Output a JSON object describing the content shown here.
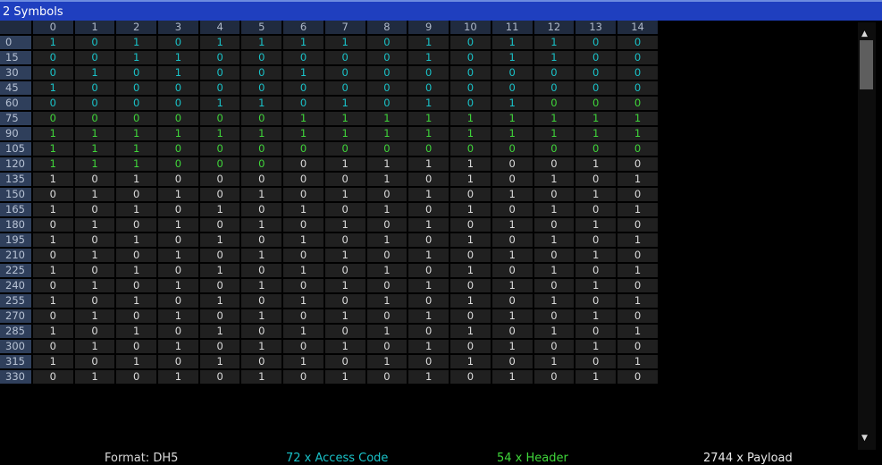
{
  "window": {
    "title": "2 Symbols"
  },
  "colors": {
    "access_code": "#19c2c8",
    "header": "#3fd63a",
    "payload": "#dcdcdc",
    "title_bar": "#1f3fbf",
    "row_header_bg": "#2f3f5b",
    "cell_bg": "#202020"
  },
  "table": {
    "column_headers": [
      "0",
      "1",
      "2",
      "3",
      "4",
      "5",
      "6",
      "7",
      "8",
      "9",
      "10",
      "11",
      "12",
      "13",
      "14"
    ],
    "rows": [
      {
        "label": "0",
        "bits": "101011110101100",
        "types": "AAAAAAAAAAAAAAA"
      },
      {
        "label": "15",
        "bits": "001100000101100",
        "types": "AAAAAAAAAAAAAAA"
      },
      {
        "label": "30",
        "bits": "010100100000000",
        "types": "AAAAAAAAAAAAAAA"
      },
      {
        "label": "45",
        "bits": "100000000000000",
        "types": "AAAAAAAAAAAAAAA"
      },
      {
        "label": "60",
        "bits": "000011010101000",
        "types": "AAAAAAAAAAAAHHH"
      },
      {
        "label": "75",
        "bits": "000000111111111",
        "types": "HHHHHHHHHHHHHHH"
      },
      {
        "label": "90",
        "bits": "111111111111111",
        "types": "HHHHHHHHHHHHHHH"
      },
      {
        "label": "105",
        "bits": "111000000000000",
        "types": "HHHHHHHHHHHHHHH"
      },
      {
        "label": "120",
        "bits": "111000011110010",
        "types": "HHHHHHPPPPPPPPP"
      },
      {
        "label": "135",
        "bits": "101000001010101",
        "types": "PPPPPPPPPPPPPPP"
      },
      {
        "label": "150",
        "bits": "010101010101010",
        "types": "PPPPPPPPPPPPPPP"
      },
      {
        "label": "165",
        "bits": "101010101010101",
        "types": "PPPPPPPPPPPPPPP"
      },
      {
        "label": "180",
        "bits": "010101010101010",
        "types": "PPPPPPPPPPPPPPP"
      },
      {
        "label": "195",
        "bits": "101010101010101",
        "types": "PPPPPPPPPPPPPPP"
      },
      {
        "label": "210",
        "bits": "010101010101010",
        "types": "PPPPPPPPPPPPPPP"
      },
      {
        "label": "225",
        "bits": "101010101010101",
        "types": "PPPPPPPPPPPPPPP"
      },
      {
        "label": "240",
        "bits": "010101010101010",
        "types": "PPPPPPPPPPPPPPP"
      },
      {
        "label": "255",
        "bits": "101010101010101",
        "types": "PPPPPPPPPPPPPPP"
      },
      {
        "label": "270",
        "bits": "010101010101010",
        "types": "PPPPPPPPPPPPPPP"
      },
      {
        "label": "285",
        "bits": "101010101010101",
        "types": "PPPPPPPPPPPPPPP"
      },
      {
        "label": "300",
        "bits": "010101010101010",
        "types": "PPPPPPPPPPPPPPP"
      },
      {
        "label": "315",
        "bits": "101010101010101",
        "types": "PPPPPPPPPPPPPPP"
      },
      {
        "label": "330",
        "bits": "010101010101010",
        "types": "PPPPPPPPPPPPPPP"
      }
    ]
  },
  "scrollbar": {
    "up_icon": "triangle-up",
    "down_icon": "triangle-down",
    "position": 0.0
  },
  "status": {
    "format": "Format: DH5",
    "access_code": "72 x Access Code",
    "header": "54 x Header",
    "payload": "2744 x Payload"
  }
}
